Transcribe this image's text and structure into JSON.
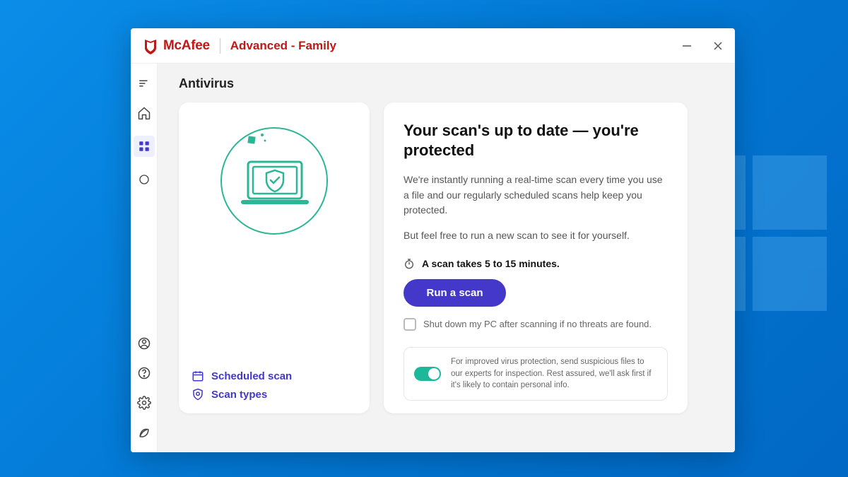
{
  "brand": {
    "name": "McAfee",
    "subscription": "Advanced - Family"
  },
  "sidebar": {
    "items": [
      "menu",
      "home",
      "apps",
      "circle"
    ],
    "bottom": [
      "account",
      "help",
      "settings",
      "leaf"
    ]
  },
  "page": {
    "title": "Antivirus"
  },
  "left_card": {
    "scheduled_scan": "Scheduled scan",
    "scan_types": "Scan types"
  },
  "right_card": {
    "headline": "Your scan's up to date — you're protected",
    "desc1": "We're instantly running a real-time scan every time you use a file and our regularly scheduled scans help keep you protected.",
    "desc2": "But feel free to run a new scan to see it for yourself.",
    "duration": "A scan takes 5 to 15 minutes.",
    "run_label": "Run a scan",
    "shutdown_label": "Shut down my PC after scanning if no threats are found.",
    "footer_label": "For improved virus protection, send suspicious files to our experts for inspection. Rest assured, we'll ask first if it's likely to contain personal info."
  }
}
